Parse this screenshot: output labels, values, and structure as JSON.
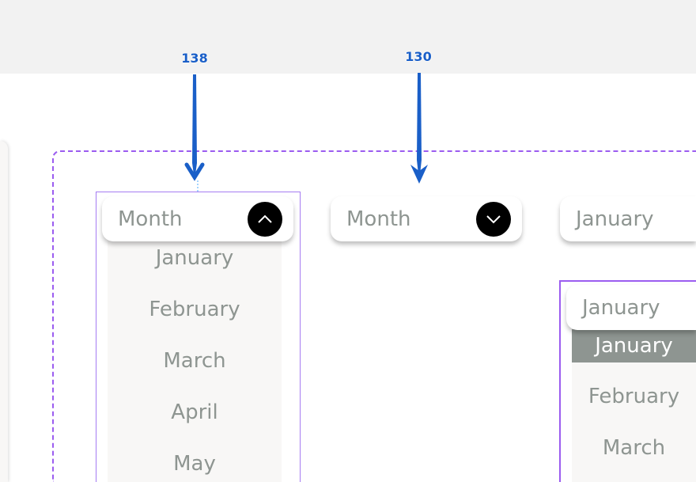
{
  "annotations": [
    {
      "label": "138"
    },
    {
      "label": "130"
    }
  ],
  "dropdown_open": {
    "placeholder": "Month",
    "icon": "chevron-up-icon",
    "options": [
      "January",
      "February",
      "March",
      "April",
      "May"
    ]
  },
  "dropdown_closed": {
    "placeholder": "Month",
    "icon": "chevron-down-icon"
  },
  "dropdown_selected": {
    "value": "January"
  },
  "dropdown_selected_open": {
    "value": "January",
    "options": [
      "January",
      "February",
      "March"
    ],
    "highlighted": "January"
  },
  "colors": {
    "accent": "#9b5cf0",
    "annotation": "#1a5fc8",
    "highlight": "#8e9591",
    "text": "#8e9591"
  }
}
